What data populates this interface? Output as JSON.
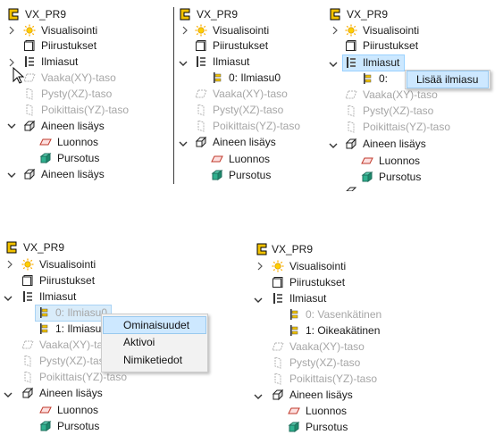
{
  "labels": {
    "root": "VX_PR9",
    "visualisointi": "Visualisointi",
    "piirustukset": "Piirustukset",
    "ilmiasut": "Ilmiasut",
    "vaaka": "Vaaka(XY)-taso",
    "pysty": "Pysty(XZ)-taso",
    "poikittais": "Poikittais(YZ)-taso",
    "aineen_lisays": "Aineen lisäys",
    "luonnos": "Luonnos",
    "pursotus": "Pursotus",
    "ilmiasu0": "0: Ilmiasu0",
    "ilmiasu0_trunc": "0:",
    "ilmiasu1": "1: Ilmiasu",
    "vasenkatinen": "0: Vasenkätinen",
    "oikeakatinen": "1: Oikeakätinen",
    "vaaka_trunc": "Vaaka(XY)-taso",
    "pysty_trunc": "Pysty(XZ)-taso",
    "poikittais_trunc": "Poikittais(YZ)-taso"
  },
  "menus": {
    "add": {
      "items": [
        "Lisää ilmiasu"
      ]
    },
    "context": {
      "items": [
        "Ominaisuudet",
        "Aktivoi",
        "Nimiketiedot"
      ]
    }
  },
  "icons": {
    "root": "part-c-icon",
    "visualisointi": "sun-icon",
    "piirustukset": "drawing-sheet-icon",
    "ilmiasut": "appearance-list-icon",
    "plane": "plane-icon",
    "feature": "extrude-feature-icon",
    "sketch": "sketch-icon",
    "body": "solid-body-icon",
    "cursor": "mouse-cursor-icon"
  },
  "colors": {
    "selection": "#cce8ff",
    "selection_border": "#99d1ff",
    "menu_bg": "#f2f2f2",
    "menu_hover": "#cde8ff",
    "disabled_text": "#a6a6a6",
    "root_icon": "#e8b800"
  }
}
